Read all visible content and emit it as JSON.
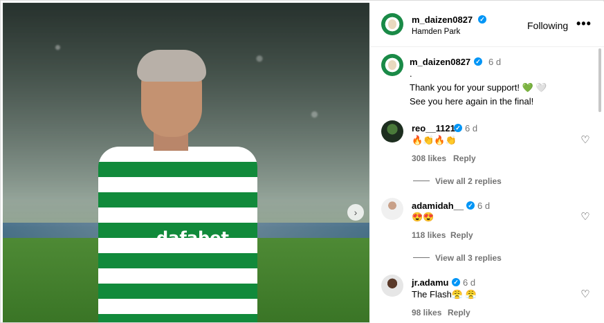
{
  "photo": {
    "sponsor_text": "dafabet",
    "next_button_icon": "chevron-right-icon",
    "next_glyph": "›"
  },
  "header": {
    "username": "m_daizen0827",
    "location": "Hamden Park",
    "follow_state": "Following",
    "more_glyph": "•••"
  },
  "caption": {
    "username": "m_daizen0827",
    "time": "6 d",
    "text": ".\nThank you for your support! 💚 🤍\nSee you here again in the final!"
  },
  "comments": [
    {
      "username": "reo__1121",
      "time": "6 d",
      "text": "🔥👏🔥👏",
      "likes": "308 likes",
      "reply": "Reply",
      "view_replies": "View all 2 replies"
    },
    {
      "username": "adamidah__",
      "time": "6 d",
      "text": "😍😍",
      "likes": "118 likes",
      "reply": "Reply",
      "view_replies": "View all 3 replies"
    },
    {
      "username": "jr.adamu",
      "time": "6 d",
      "text": "The Flash😤 😤",
      "likes": "98 likes",
      "reply": "Reply"
    }
  ],
  "icons": {
    "verified_glyph": "✓",
    "heart_glyph": "♡"
  },
  "colors": {
    "verified_blue": "#0095f6",
    "celtic_green": "#118a3b",
    "muted_text": "#737373"
  }
}
